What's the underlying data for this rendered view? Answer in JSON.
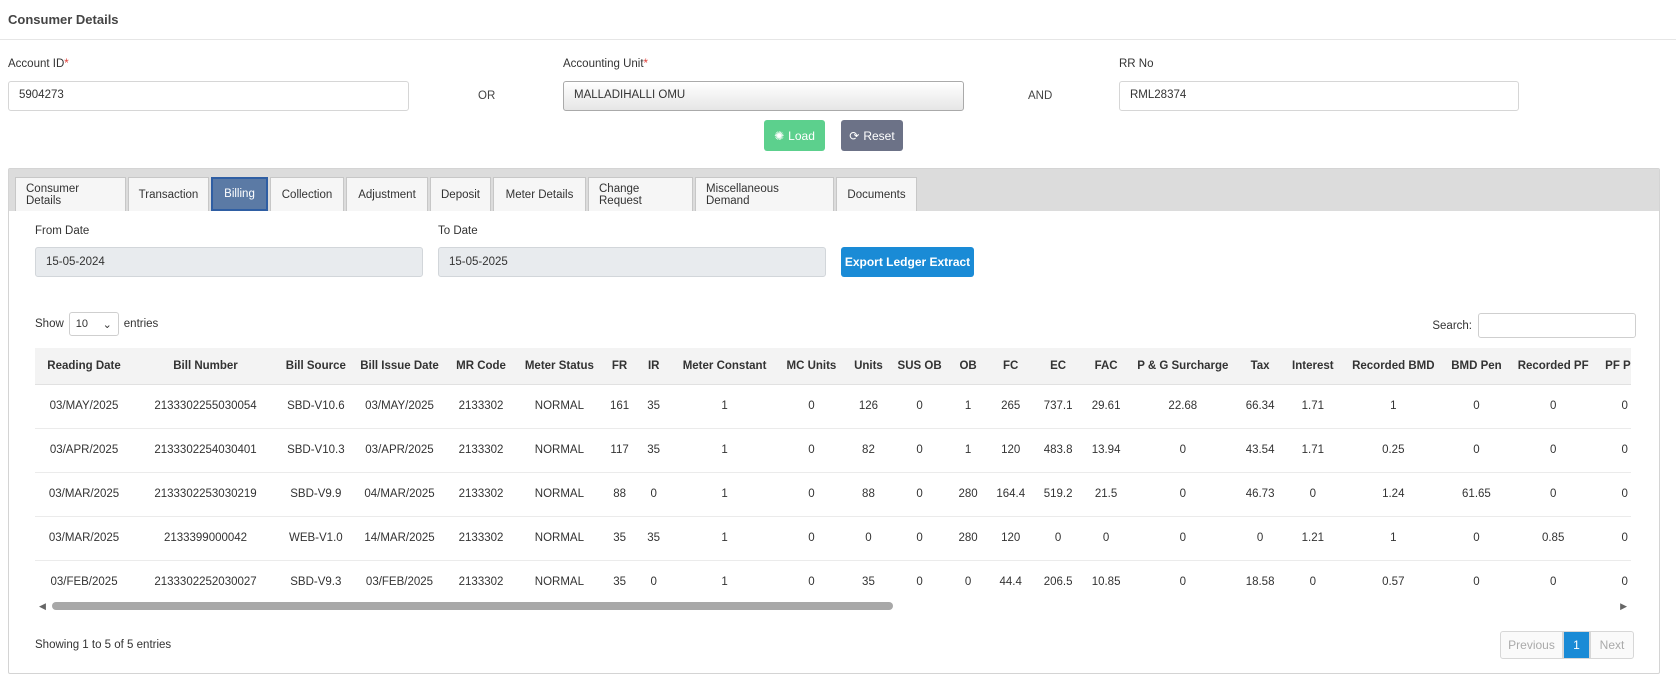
{
  "page": {
    "title": "Consumer Details"
  },
  "form": {
    "account_id_label": "Account ID",
    "account_id_value": "5904273",
    "or_text": "OR",
    "unit_label": "Accounting Unit",
    "unit_value": "MALLADIHALLI OMU",
    "and_text": "AND",
    "rr_label": "RR No",
    "rr_value": "RML28374",
    "required_mark": "*"
  },
  "buttons": {
    "load": "Load",
    "reset": "Reset",
    "export": "Export Ledger Extract"
  },
  "tabs": [
    {
      "label": "Consumer Details",
      "active": false
    },
    {
      "label": "Transaction",
      "active": false
    },
    {
      "label": "Billing",
      "active": true
    },
    {
      "label": "Collection",
      "active": false
    },
    {
      "label": "Adjustment",
      "active": false
    },
    {
      "label": "Deposit",
      "active": false
    },
    {
      "label": "Meter Details",
      "active": false
    },
    {
      "label": "Change Request",
      "active": false
    },
    {
      "label": "Miscellaneous Demand",
      "active": false
    },
    {
      "label": "Documents",
      "active": false
    }
  ],
  "billing": {
    "from_date_label": "From Date",
    "from_date_value": "15-05-2024",
    "to_date_label": "To Date",
    "to_date_value": "15-05-2025"
  },
  "table_controls": {
    "show_label": "Show",
    "entries_value": "10",
    "entries_label": "entries",
    "search_label": "Search:"
  },
  "table": {
    "columns": [
      "Reading Date",
      "Bill Number",
      "Bill Source",
      "Bill Issue Date",
      "MR Code",
      "Meter Status",
      "FR",
      "IR",
      "Meter Constant",
      "MC Units",
      "Units",
      "SUS OB",
      "OB",
      "FC",
      "EC",
      "FAC",
      "P & G Surcharge",
      "Tax",
      "Interest",
      "Recorded BMD",
      "BMD Pen",
      "Recorded PF",
      "PF Pen"
    ],
    "rows": [
      [
        "03/MAY/2025",
        "2133302255030054",
        "SBD-V10.6",
        "03/MAY/2025",
        "2133302",
        "NORMAL",
        "161",
        "35",
        "1",
        "0",
        "126",
        "0",
        "1",
        "265",
        "737.1",
        "29.61",
        "22.68",
        "66.34",
        "1.71",
        "1",
        "0",
        "0",
        "0"
      ],
      [
        "03/APR/2025",
        "2133302254030401",
        "SBD-V10.3",
        "03/APR/2025",
        "2133302",
        "NORMAL",
        "117",
        "35",
        "1",
        "0",
        "82",
        "0",
        "1",
        "120",
        "483.8",
        "13.94",
        "0",
        "43.54",
        "1.71",
        "0.25",
        "0",
        "0",
        "0"
      ],
      [
        "03/MAR/2025",
        "2133302253030219",
        "SBD-V9.9",
        "04/MAR/2025",
        "2133302",
        "NORMAL",
        "88",
        "0",
        "1",
        "0",
        "88",
        "0",
        "280",
        "164.4",
        "519.2",
        "21.5",
        "0",
        "46.73",
        "0",
        "1.24",
        "61.65",
        "0",
        "0"
      ],
      [
        "03/MAR/2025",
        "2133399000042",
        "WEB-V1.0",
        "14/MAR/2025",
        "2133302",
        "NORMAL",
        "35",
        "35",
        "1",
        "0",
        "0",
        "0",
        "280",
        "120",
        "0",
        "0",
        "0",
        "0",
        "1.21",
        "1",
        "0",
        "0.85",
        "0"
      ],
      [
        "03/FEB/2025",
        "2133302252030027",
        "SBD-V9.3",
        "03/FEB/2025",
        "2133302",
        "NORMAL",
        "35",
        "0",
        "1",
        "0",
        "35",
        "0",
        "0",
        "44.4",
        "206.5",
        "10.85",
        "0",
        "18.58",
        "0",
        "0.57",
        "0",
        "0",
        "0"
      ]
    ]
  },
  "footer": {
    "showing_text": "Showing 1 to 5 of 5 entries",
    "prev_label": "Previous",
    "page_label": "1",
    "next_label": "Next"
  },
  "colors": {
    "load_button": "#5cd08d",
    "reset_button": "#6c7287",
    "active_tab": "#5b7aa5",
    "export_button": "#1a8bd6",
    "required_asterisk": "#e0403a"
  },
  "icons": {
    "load": "spinner-icon",
    "reset": "refresh-icon"
  }
}
